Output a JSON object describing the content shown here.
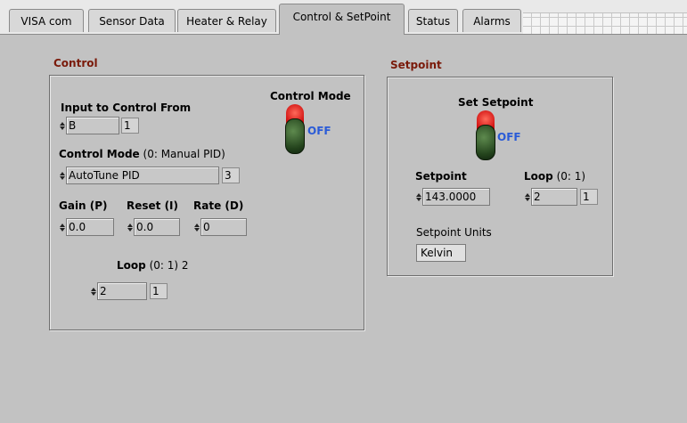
{
  "tabs": [
    {
      "label": "VISA com"
    },
    {
      "label": "Sensor Data"
    },
    {
      "label": "Heater & Relay"
    },
    {
      "label": "Control & SetPoint"
    },
    {
      "label": "Status"
    },
    {
      "label": "Alarms"
    }
  ],
  "control": {
    "title": "Control",
    "input_label": "Input to Control From",
    "input_value": "B",
    "input_index": "1",
    "mode_label_bold": "Control Mode",
    "mode_label_note": "(0: Manual PID)",
    "mode_value": "AutoTune PID",
    "mode_index": "3",
    "gain_label": "Gain (P)",
    "gain_value": "0.0",
    "reset_label": "Reset (I)",
    "reset_value": "0.0",
    "rate_label": "Rate (D)",
    "rate_value": "0",
    "loop_label_bold": "Loop",
    "loop_label_note": "(0: 1) 2",
    "loop_value": "2",
    "loop_index": "1",
    "toggle_label": "Control Mode",
    "toggle_state": "OFF"
  },
  "setpoint": {
    "title": "Setpoint",
    "toggle_label": "Set Setpoint",
    "toggle_state": "OFF",
    "setpoint_label": "Setpoint",
    "setpoint_value": "143.0000",
    "loop_label_bold": "Loop",
    "loop_label_note": "(0: 1)",
    "loop_value": "2",
    "loop_index": "1",
    "units_label": "Setpoint Units",
    "units_value": "Kelvin"
  },
  "colors": {
    "group_title": "#7a1a0a",
    "off_text": "#2a5bd7",
    "panel": "#c2c2c2"
  }
}
